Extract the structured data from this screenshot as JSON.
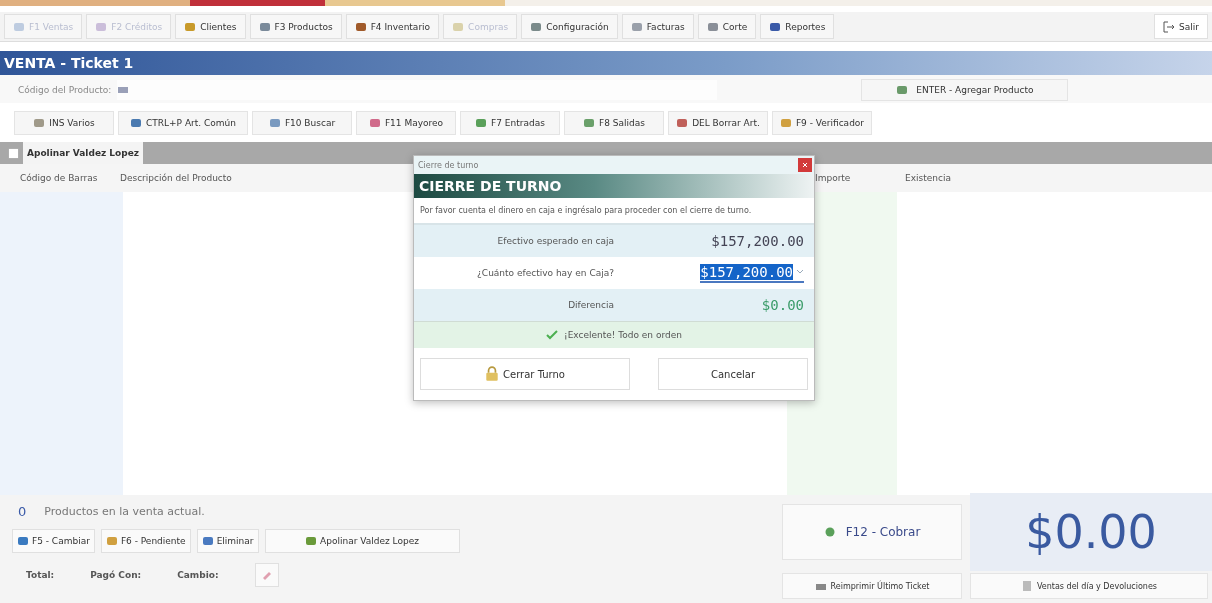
{
  "toolbar": [
    {
      "label": "F1 Ventas",
      "disabled": true
    },
    {
      "label": "F2 Créditos",
      "disabled": true
    },
    {
      "label": "Clientes",
      "disabled": false
    },
    {
      "label": "F3 Productos",
      "disabled": false
    },
    {
      "label": "F4 Inventario",
      "disabled": false
    },
    {
      "label": "Compras",
      "disabled": true
    },
    {
      "label": "Configuración",
      "disabled": false
    },
    {
      "label": "Facturas",
      "disabled": false
    },
    {
      "label": "Corte",
      "disabled": false
    },
    {
      "label": "Reportes",
      "disabled": false
    }
  ],
  "exit_button": "Salir",
  "title": "VENTA - Ticket 1",
  "product_code": {
    "label": "Código del Producto:",
    "add_button": "ENTER - Agregar Producto"
  },
  "actions": [
    "INS Varios",
    "CTRL+P Art. Común",
    "F10 Buscar",
    "F11 Mayoreo",
    "F7 Entradas",
    "F8 Salidas",
    "DEL Borrar Art.",
    "F9 - Verificador"
  ],
  "tab_checkbox": {
    "checked": false
  },
  "tabs": [
    {
      "label": "Apolinar Valdez Lopez",
      "selected": true
    }
  ],
  "table": {
    "columns": [
      "Código de Barras",
      "Descripción del Producto",
      "Importe",
      "Existencia"
    ]
  },
  "dialog": {
    "title": "Cierre de turno",
    "heading": "CIERRE DE TURNO",
    "message": "Por favor cuenta el dinero en caja e ingrésalo para proceder con el cierre de turno.",
    "rows": [
      {
        "kind": "text",
        "label": "Efectivo esperado en caja",
        "value": "$157,200.00"
      },
      {
        "kind": "input",
        "label": "¿Cuánto efectivo hay en Caja?",
        "value": "$157,200.00"
      },
      {
        "kind": "difference",
        "label": "Diferencia",
        "value": "$0.00"
      }
    ],
    "status": "¡Excelente! Todo en orden",
    "buttons": [
      "Cerrar Turno",
      "Cancelar"
    ]
  },
  "summary": {
    "count": "0",
    "text": "Productos en la venta actual."
  },
  "bottom_buttons": [
    "F5 - Cambiar",
    "F6 - Pendiente",
    "Eliminar",
    "Apolinar Valdez Lopez"
  ],
  "totals": [
    "Total:",
    "Pagó Con:",
    "Cambio:"
  ],
  "charge_button": "F12 - Cobrar",
  "total_amount": "$0.00",
  "reprint_button": "Reimprimir Último Ticket",
  "sales_button": "Ventas del día y Devoluciones"
}
